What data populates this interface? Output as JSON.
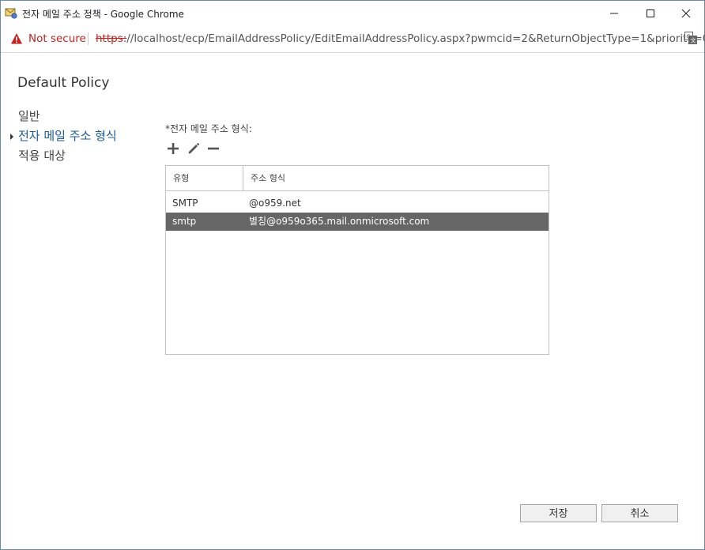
{
  "window": {
    "title": "전자 메일 주소 정책 - Google Chrome",
    "icon": "mail-policy-icon",
    "controls": [
      "minimize-icon",
      "maximize-icon",
      "close-icon"
    ]
  },
  "addressbar": {
    "security_label": "Not secure",
    "url_scheme": "https:",
    "url_rest": "//localhost/ecp/EmailAddressPolicy/EditEmailAddressPolicy.aspx?pwmcid=2&ReturnObjectType=1&priority=0..."
  },
  "page": {
    "title": "Default Policy"
  },
  "nav": {
    "items": [
      {
        "label": "일반",
        "active": false
      },
      {
        "label": "전자 메일 주소 형식",
        "active": true
      },
      {
        "label": "적용 대상",
        "active": false
      }
    ]
  },
  "email_formats": {
    "label": "*전자 메일 주소 형식:",
    "toolbar": [
      "add-icon",
      "edit-icon",
      "remove-icon"
    ],
    "columns": [
      "유형",
      "주소 형식"
    ],
    "rows": [
      {
        "type": "SMTP",
        "address": "@o959.net",
        "selected": false
      },
      {
        "type": "smtp",
        "address": "별칭@o959o365.mail.onmicrosoft.com",
        "selected": true
      }
    ]
  },
  "footer": {
    "save_label": "저장",
    "cancel_label": "취소"
  },
  "colors": {
    "accent": "#1a5a96",
    "selected_row": "#666666",
    "warning": "#c5221f"
  }
}
